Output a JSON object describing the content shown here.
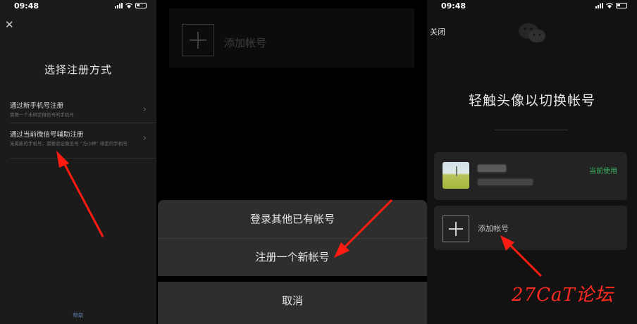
{
  "status_bar": {
    "time": "09:48"
  },
  "panel1": {
    "close_icon": "close-icon",
    "title": "选择注册方式",
    "options": [
      {
        "title": "通过新手机号注册",
        "subtitle": "需要一个未绑定微信号的手机号"
      },
      {
        "title": "通过当前微信号辅助注册",
        "subtitle": "无需新的手机号，需要验证微信号 “万小婷” 绑定的手机号"
      }
    ],
    "help": "帮助"
  },
  "panel2": {
    "add_account_label": "添加帐号",
    "sheet": {
      "login_other": "登录其他已有帐号",
      "register_new": "注册一个新帐号",
      "cancel": "取消"
    }
  },
  "panel3": {
    "close": "关闭",
    "logo": "wechat-logo",
    "title": "轻触头像以切换帐号",
    "current_badge": "当前使用",
    "add_account_label": "添加帐号",
    "watermark": "27CaT论坛"
  },
  "colors": {
    "arrow": "#ff1a12",
    "accent_green": "#3bb35f",
    "link_blue": "#5d7fa8"
  }
}
